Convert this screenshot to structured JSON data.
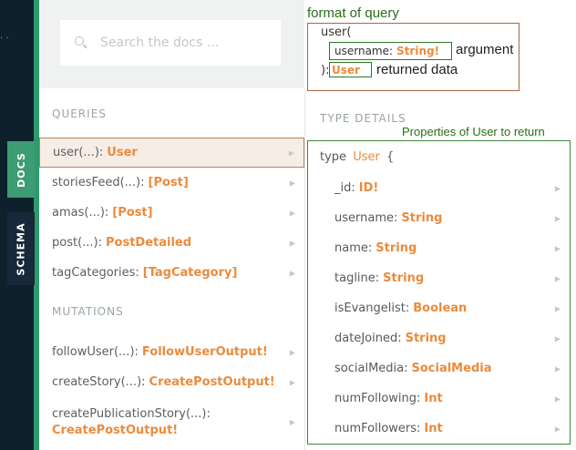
{
  "sidebar": {
    "rail_dots": "· ·",
    "tabs": [
      {
        "label": "DOCS",
        "active": true
      },
      {
        "label": "SCHEMA",
        "active": false
      }
    ]
  },
  "search": {
    "placeholder": "Search the docs ..."
  },
  "queries": {
    "title": "QUERIES",
    "items": [
      {
        "name": "user(...):",
        "type": "User",
        "selected": true
      },
      {
        "name": "storiesFeed(...):",
        "type": "[Post]"
      },
      {
        "name": "amas(...):",
        "type": "[Post]"
      },
      {
        "name": "post(...):",
        "type": "PostDetailed"
      },
      {
        "name": "tagCategories:",
        "type": "[TagCategory]"
      }
    ]
  },
  "mutations": {
    "title": "MUTATIONS",
    "items": [
      {
        "name": "followUser(...):",
        "type": "FollowUserOutput!"
      },
      {
        "name": "createStory(...):",
        "type": "CreatePostOutput!"
      },
      {
        "name": "createPublicationStory(...):",
        "type": "CreatePostOutput!"
      }
    ]
  },
  "annotation": {
    "format_label": "format of query",
    "query_open": "user(",
    "arg_name": "username:",
    "arg_type": "String!",
    "arg_label": "argument",
    "query_close": "):",
    "return_type": "User",
    "return_label": "returned data",
    "props_label": "Properties of User to return"
  },
  "type_details": {
    "title": "TYPE DETAILS",
    "keyword": "type",
    "type_name": "User",
    "brace": "{",
    "fields": [
      {
        "name": "_id:",
        "type": "ID!"
      },
      {
        "name": "username:",
        "type": "String"
      },
      {
        "name": "name:",
        "type": "String"
      },
      {
        "name": "tagline:",
        "type": "String"
      },
      {
        "name": "isEvangelist:",
        "type": "Boolean"
      },
      {
        "name": "dateJoined:",
        "type": "String"
      },
      {
        "name": "socialMedia:",
        "type": "SocialMedia"
      },
      {
        "name": "numFollowing:",
        "type": "Int"
      },
      {
        "name": "numFollowers:",
        "type": "Int"
      }
    ]
  },
  "colors": {
    "accent": "#eb8b3c",
    "docs_tab": "#3c9d72",
    "annotation_green": "#2a6e14",
    "annotation_brown": "#a56a45"
  }
}
